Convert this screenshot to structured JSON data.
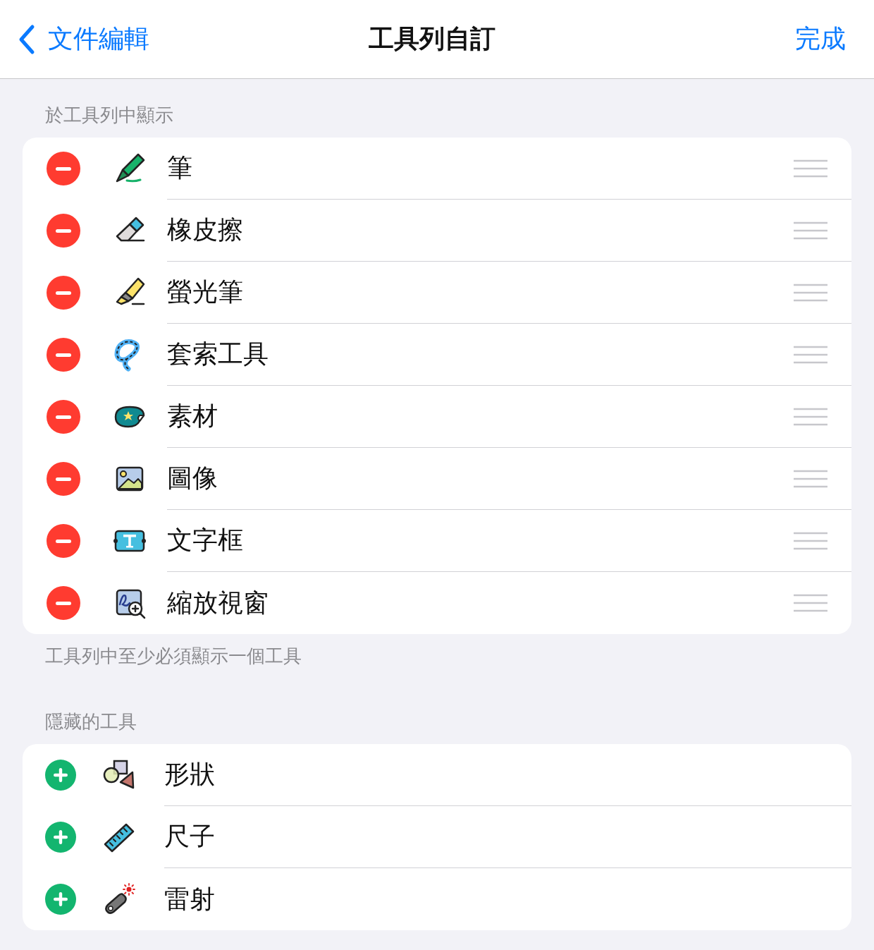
{
  "nav_bar": {
    "back_label": "文件編輯",
    "title": "工具列自訂",
    "done_label": "完成"
  },
  "sections": [
    {
      "header": "於工具列中顯示",
      "footer": "工具列中至少必須顯示一個工具",
      "items": [
        {
          "label": "筆",
          "kind": "pen",
          "removable": true
        },
        {
          "label": "橡皮擦",
          "kind": "eraser",
          "removable": true
        },
        {
          "label": "螢光筆",
          "kind": "highlighter",
          "removable": true
        },
        {
          "label": "套索工具",
          "kind": "lasso",
          "removable": true
        },
        {
          "label": "素材",
          "kind": "sticker",
          "removable": true
        },
        {
          "label": "圖像",
          "kind": "image",
          "removable": true
        },
        {
          "label": "文字框",
          "kind": "textbox",
          "removable": true
        },
        {
          "label": "縮放視窗",
          "kind": "zoom",
          "removable": true
        }
      ]
    },
    {
      "header": "隱藏的工具",
      "items": [
        {
          "label": "形狀",
          "kind": "shapes",
          "removable": false
        },
        {
          "label": "尺子",
          "kind": "ruler",
          "removable": false
        },
        {
          "label": "雷射",
          "kind": "laser",
          "removable": false
        }
      ]
    }
  ]
}
